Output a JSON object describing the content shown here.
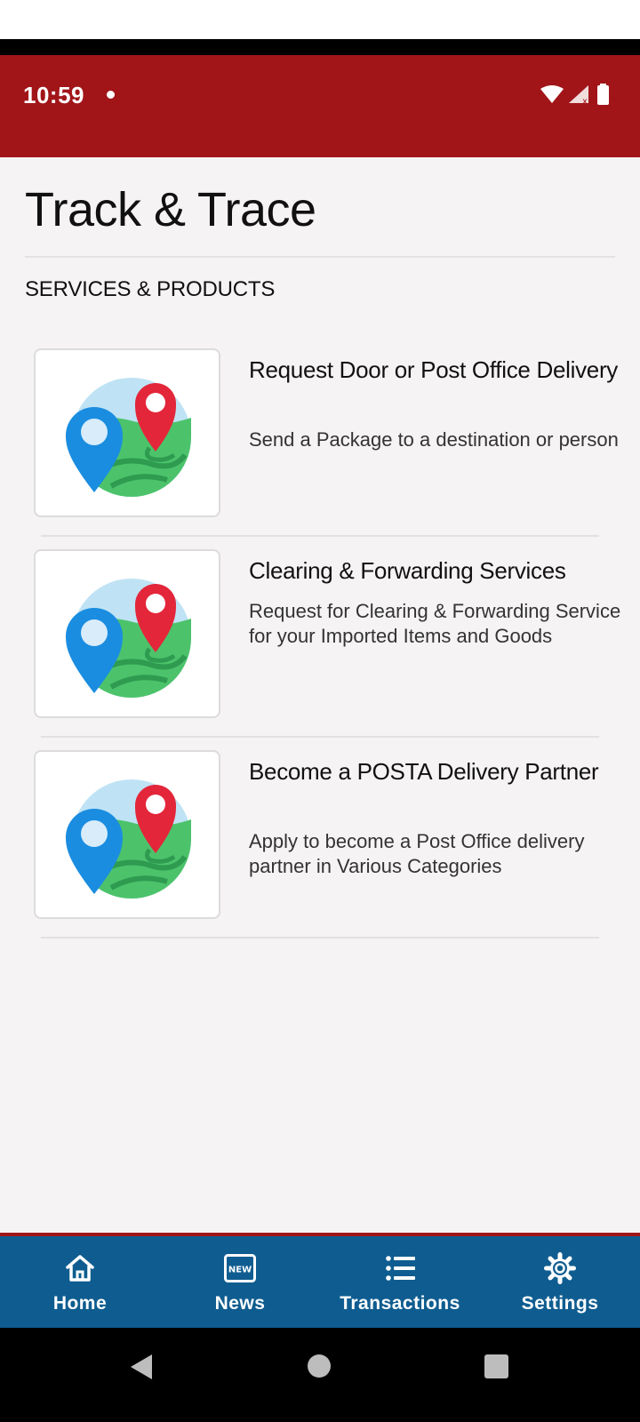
{
  "status_bar": {
    "time": "10:59",
    "icons": [
      "notification-dot-icon",
      "wifi-icon",
      "signal-icon",
      "battery-icon"
    ],
    "background_color": "#a11519"
  },
  "page": {
    "title": "Track & Trace",
    "section_heading": "SERVICES & PRODUCTS"
  },
  "services": [
    {
      "title": "Request Door or Post Office Delivery",
      "description": "Send a Package to a destination or person",
      "icon": "map-location-pins-icon"
    },
    {
      "title": "Clearing & Forwarding Services",
      "description": "Request for Clearing & Forwarding Service for your Imported Items and Goods",
      "icon": "map-location-pins-icon"
    },
    {
      "title": "Become a POSTA Delivery Partner",
      "description": "Apply to become a Post Office delivery partner in Various Categories",
      "icon": "map-location-pins-icon"
    }
  ],
  "bottom_nav": {
    "background_color": "#0f5d90",
    "items": [
      {
        "label": "Home",
        "icon": "home-icon"
      },
      {
        "label": "News",
        "icon": "news-icon",
        "badge_text": "NEW"
      },
      {
        "label": "Transactions",
        "icon": "list-icon"
      },
      {
        "label": "Settings",
        "icon": "gear-icon"
      }
    ]
  },
  "system_nav": {
    "icons": [
      "back-icon",
      "home-circle-icon",
      "recents-icon"
    ]
  }
}
